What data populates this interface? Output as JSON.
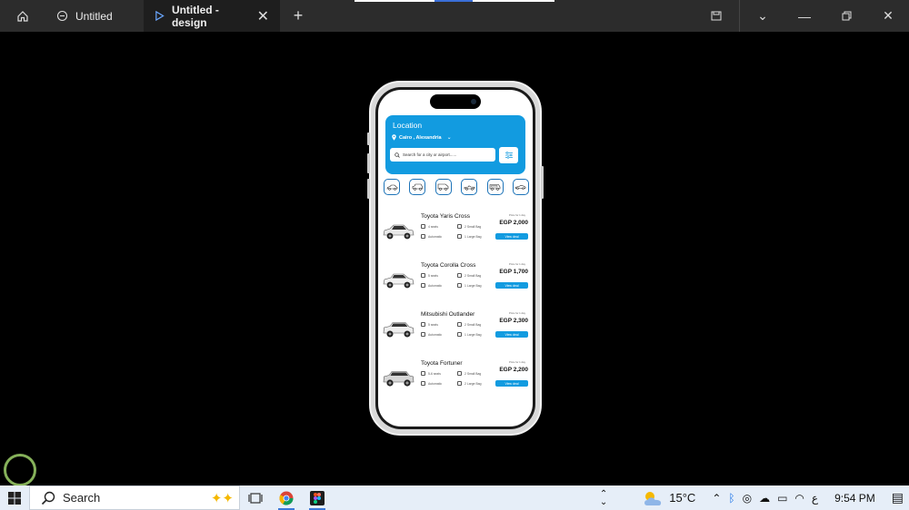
{
  "window": {
    "tabs": [
      {
        "label": "Untitled"
      },
      {
        "label": "Untitled - design"
      }
    ]
  },
  "app": {
    "location_title": "Location",
    "location_value": "Cairo , Alexandria",
    "search_placeholder": "Search for a city or airport......",
    "categories": [
      "sedan-icon",
      "suv-icon",
      "van-icon",
      "convertible-icon",
      "minibus-icon",
      "sports-car-icon"
    ],
    "price_per_day_label": "Price for 1 day",
    "view_deal_label": "View deal",
    "cars": [
      {
        "name": "Toyota Yaris  Cross",
        "seats": "4 seats",
        "bags_small": "2 Small Bag",
        "transmission": "Automatic",
        "bags_large": "1 Large Bag",
        "price": "EGP 2,000"
      },
      {
        "name": "Toyota Corolla Cross",
        "seats": "5 seats",
        "bags_small": "2 Small Bag",
        "transmission": "Automatic",
        "bags_large": "1 Large Bag",
        "price": "EGP 1,700"
      },
      {
        "name": "Mitsubishi Outlander",
        "seats": "5 seats",
        "bags_small": "2 Small Bag",
        "transmission": "Automatic",
        "bags_large": "1 Large Bag",
        "price": "EGP 2,300"
      },
      {
        "name": "Toyota Fortuner",
        "seats": "5-6 seats",
        "bags_small": "2 Small Bag",
        "transmission": "Automatic",
        "bags_large": "2 Large Bag",
        "price": "EGP 2,200"
      }
    ]
  },
  "taskbar": {
    "search_label": "Search",
    "temperature": "15°C",
    "lang": "ع",
    "time": "9:54 PM"
  },
  "colors": {
    "accent": "#129be0",
    "titlebar": "#2c2c2c",
    "taskbar": "#e6eef8"
  }
}
